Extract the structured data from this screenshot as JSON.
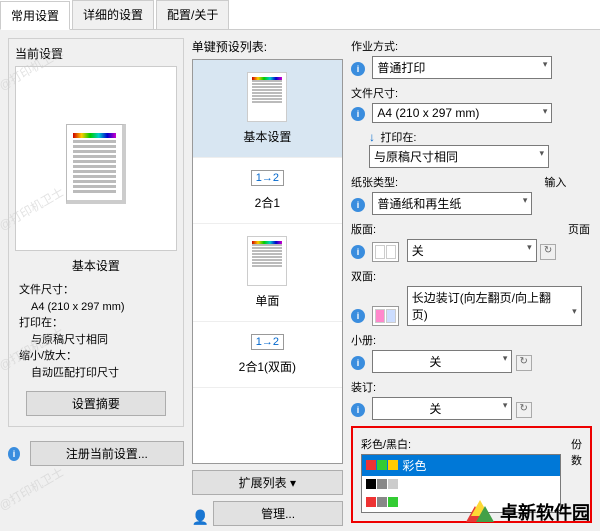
{
  "watermark": "@打印机卫士",
  "tabs": [
    "常用设置",
    "详细的设置",
    "配置/关于"
  ],
  "left": {
    "group_title": "当前设置",
    "preset_name": "基本设置",
    "rows": [
      {
        "k": "文件尺寸：",
        "v": "A4 (210 x 297 mm)"
      },
      {
        "k": "打印在：",
        "v": "与原稿尺寸相同"
      },
      {
        "k": "缩小/放大：",
        "v": "自动匹配打印尺寸"
      }
    ],
    "summary_btn": "设置摘要",
    "register_btn": "注册当前设置..."
  },
  "mid": {
    "title": "单键预设列表:",
    "items": [
      "基本设置",
      "2合1",
      "单面",
      "2合1(双面)"
    ],
    "item_badges": [
      "",
      "1→2",
      "",
      "1→2"
    ],
    "expand_btn": "扩展列表 ▾",
    "manage_btn": "管理..."
  },
  "right": {
    "job_label": "作业方式:",
    "job_value": "普通打印",
    "size_label": "文件尺寸:",
    "size_value": "A4 (210 x 297 mm)",
    "print_on_label": "打印在:",
    "print_on_value": "与原稿尺寸相同",
    "paper_label": "纸张类型:",
    "paper_value": "普通纸和再生纸",
    "input_label": "输入",
    "layout_label": "版面:",
    "layout_value": "关",
    "page_label": "页面",
    "duplex_label": "双面:",
    "duplex_value": "长边装订(向左翻页/向上翻页)",
    "booklet_label": "小册:",
    "booklet_value": "关",
    "binding_label": "装订:",
    "binding_value": "关",
    "color_label": "彩色/黑白:",
    "color_options": [
      "彩色"
    ],
    "copies_label": "份数"
  },
  "logo": "卓新软件园"
}
